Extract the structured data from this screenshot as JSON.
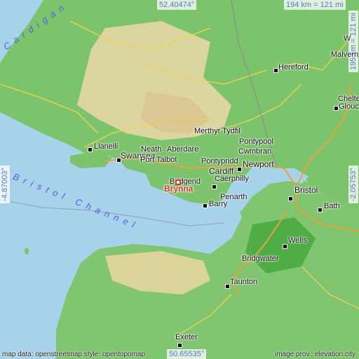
{
  "map": {
    "top_coord": "52.40474°",
    "bottom_coord": "50.65535°",
    "left_coord": "-4.87003°",
    "right_coord": "-2.05753°",
    "scale_h": "194 km = 121 mi",
    "scale_v": "195 km = 121 mi",
    "attribution_left": "map data: openstreetmap  style: opentopomap",
    "attribution_right": "image prov.: elevation.city",
    "marker_label": "Brynna",
    "water_label_bay": "Cardigan",
    "water_label_channel": "Bristol Channel",
    "colors": {
      "sea": "#a6d3ea",
      "lowland": "#78c06a",
      "upland": "#e7d9a8",
      "marker": "#e03030"
    }
  },
  "places": {
    "hereford": "Hereford",
    "malvern": "Malvern",
    "cheltenham": "Chelte",
    "gloucester": "Glouc",
    "merthyr": "Merthyr Tydfil",
    "pontypool": "Pontypool",
    "cwmbran": "Cwmbran",
    "newport": "Newport",
    "llanelli": "Llanelli",
    "neath": "Neath",
    "aberdare": "Aberdare",
    "swansea": "Swansea",
    "port_talbot": "Port Talbot",
    "pontypridd": "Pontypridd",
    "caerphilly": "Caerphilly",
    "cardiff": "Cardiff",
    "bridgend": "Bridgend",
    "penarth": "Penarth",
    "barry": "Barry",
    "bristol": "Bristol",
    "bath": "Bath",
    "wells": "Wells",
    "bridgwater": "Bridgwater",
    "taunton": "Taunton",
    "exeter": "Exeter",
    "top_right_w": "W"
  }
}
